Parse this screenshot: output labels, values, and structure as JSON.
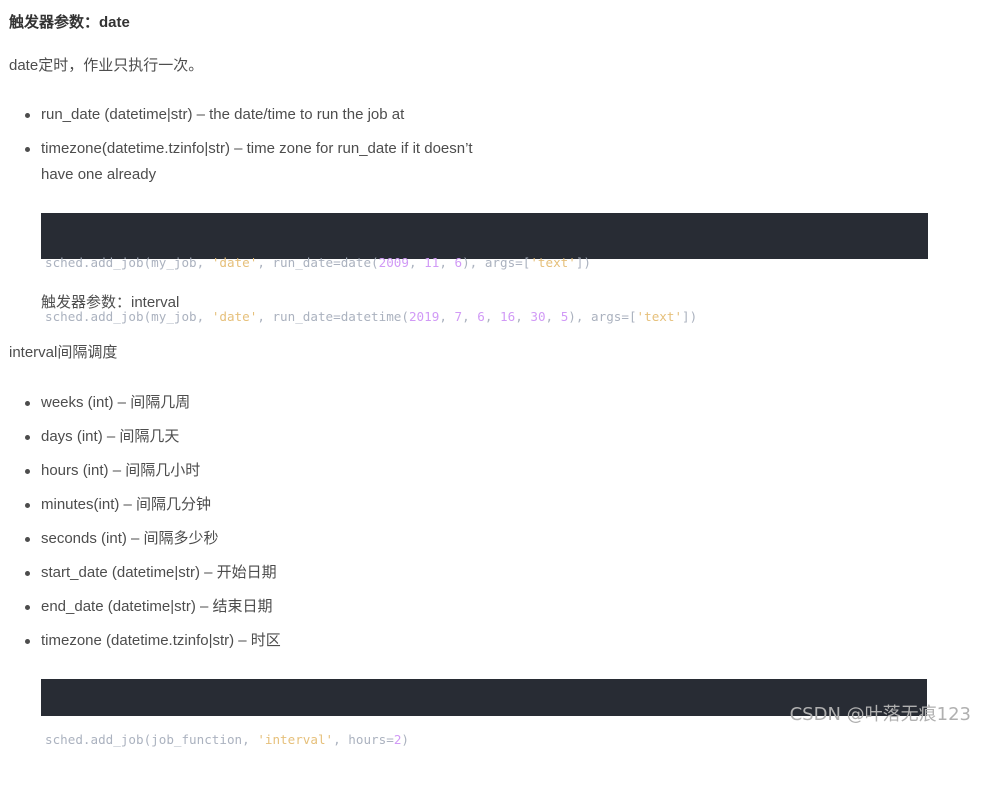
{
  "sections": {
    "date_heading": "触发器参数：date",
    "date_desc": "date定时，作业只执行一次。",
    "date_params": [
      "run_date (datetime|str) – the date/time to run the job at",
      "timezone(datetime.tzinfo|str) – time zone for run_date if it doesn’t",
      "have one already"
    ],
    "code1": {
      "line1": {
        "p1": "sched.add_job(my_job, ",
        "s1": "'date'",
        "p2": ", run_date=date(",
        "n1": "2009",
        "p3": ", ",
        "n2": "11",
        "p4": ", ",
        "n3": "6",
        "p5": "), args=[",
        "s2": "'text'",
        "p6": "])"
      },
      "line2": {
        "p1": "sched.add_job(my_job, ",
        "s1": "'date'",
        "p2": ", run_date=datetime(",
        "n1": "2019",
        "p3": ", ",
        "n2": "7",
        "p4": ", ",
        "n3": "6",
        "p5": ", ",
        "n4": "16",
        "p6": ", ",
        "n5": "30",
        "p7": ", ",
        "n6": "5",
        "p8": "), args=[",
        "s2": "'text'",
        "p9": "])"
      }
    },
    "interval_heading": "触发器参数：interval",
    "interval_desc": "interval间隔调度",
    "interval_params": [
      "weeks (int) – 间隔几周",
      "days (int) – 间隔几天",
      "hours (int) – 间隔几小时",
      "minutes(int) – 间隔几分钟",
      "seconds (int) – 间隔多少秒",
      "start_date (datetime|str) – 开始日期",
      "end_date (datetime|str) – 结束日期",
      "timezone (datetime.tzinfo|str) – 时区"
    ],
    "code2": {
      "p1": "sched.add_job(job_function, ",
      "s1": "'interval'",
      "p2": ", hours=",
      "n1": "2",
      "p3": ")"
    }
  },
  "watermark": "CSDN @叶落无痕123",
  "colors": {
    "code_bg": "#282c34",
    "code_text": "#abb2bf",
    "string": "#e6c07b",
    "number": "#d19af6"
  }
}
